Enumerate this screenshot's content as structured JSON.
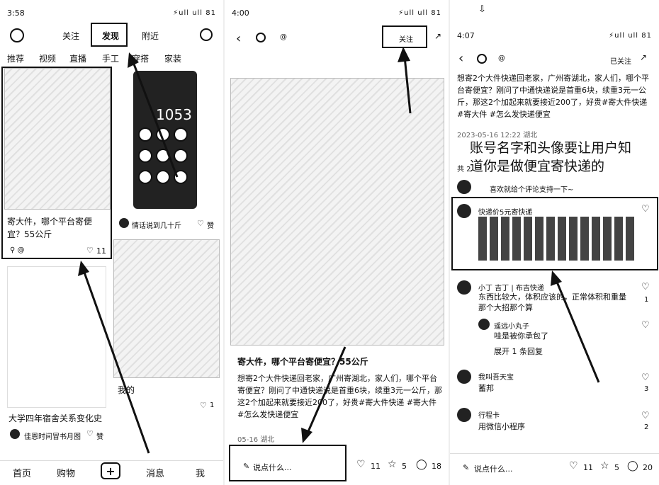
{
  "p1": {
    "time": "3:58",
    "signal": "⚡ull ull 81",
    "nav": {
      "follow": "关注",
      "discover": "发现",
      "nearby": "附近"
    },
    "tabs": [
      "推荐",
      "视频",
      "直播",
      "手工",
      "穿搭",
      "家装"
    ],
    "card1": {
      "title": "寄大件，哪个平台寄便宜？55公斤",
      "likes": "11"
    },
    "card2": {
      "author": "情话说到几十斤",
      "likes_label": "赞"
    },
    "card3": {
      "title": "大学四年宿舍关系变化史",
      "author": "佳恩时间冒书月图",
      "likes_label": "赞"
    },
    "card4": {
      "title": "我的",
      "likes": "1"
    },
    "bottom": {
      "home": "首页",
      "shop": "购物",
      "add": "+",
      "msg": "消息",
      "me": "我"
    }
  },
  "p2": {
    "time": "4:00",
    "at": "@",
    "follow": "关注",
    "title": "寄大件，哪个平台寄便宜？55公斤",
    "body": "想寄2个大件快递回老家，广州寄湖北，家人们，哪个平台寄便宜？刚问了中通快递说是首重6块，续重3元一公斤，那这2个加起来就要接近200了，好贵#寄大件快递 #寄大件  #怎么发快递便宜",
    "date": "05-16 湖北",
    "comment_placeholder": "说点什么...",
    "likes": "11",
    "stars": "5",
    "comments": "18"
  },
  "p3": {
    "time": "4:07",
    "at": "@",
    "follow": "已关注",
    "body": "想寄2个大件快递回老家，广州寄湖北，家人们，哪个平台寄便宜？刚问了中通快递说是首重6块，续重3元一公斤，那这2个加起来就要接近200了，好贵#寄大件快递 #寄大件  #怎么发快递便宜",
    "date_line": "2023-05-16 12:22 湖北",
    "overlay_line1": "账号名字和头像要让用户知",
    "overlay_line2": "道你是做便宜寄快递的",
    "overlay_prefix": "共 2",
    "shared_text": "喜欢就给个评论支持一下~",
    "hl_comment_user": "快递价5元寄快递",
    "c1": {
      "user": "小丁 吉丁 | 布吉快递",
      "text": "东西比较大，体积应该的，正常体积和重量那个大招那个算",
      "likes": "1"
    },
    "c1_reply": {
      "user": "遥远小丸子",
      "text": "哇是被你承包了",
      "likes": ""
    },
    "expand": "展开 1 条回复",
    "c2": {
      "user": "我叫吾天宝",
      "text": "蓄邦",
      "likes": "3"
    },
    "c3": {
      "user": "行程卡",
      "text": "用微信小程序",
      "likes": "2"
    },
    "comment_placeholder": "说点什么...",
    "likes": "11",
    "stars": "5",
    "comments": "20"
  }
}
